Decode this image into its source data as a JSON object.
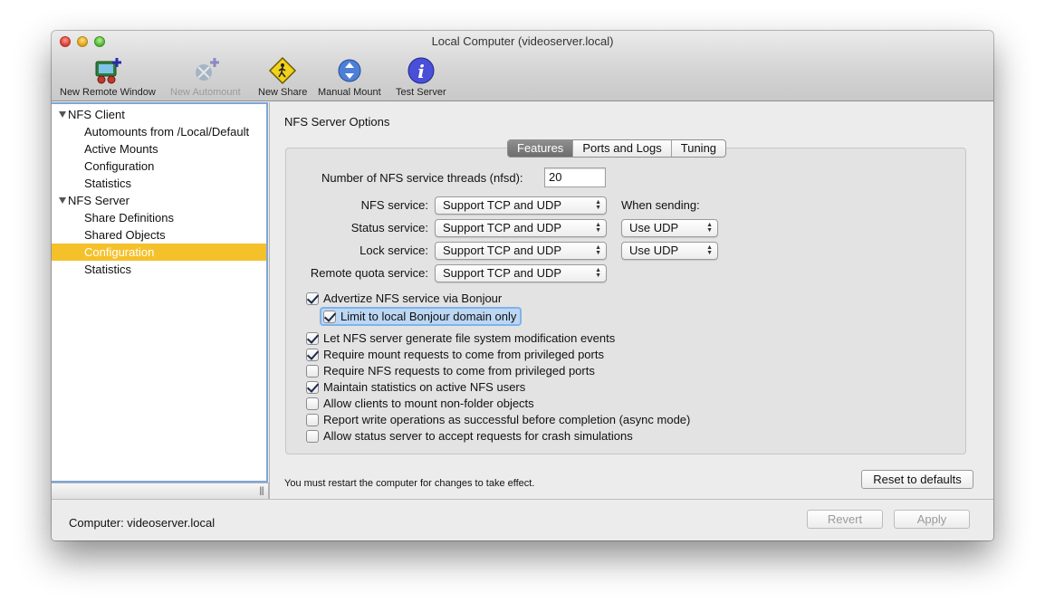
{
  "window": {
    "title": "Local Computer (videoserver.local)"
  },
  "toolbar": [
    {
      "label": "New Remote Window",
      "icon": "remote-window-icon",
      "enabled": true
    },
    {
      "label": "New Automount",
      "icon": "automount-icon",
      "enabled": false
    },
    {
      "label": "New Share",
      "icon": "share-sign-icon",
      "enabled": true
    },
    {
      "label": "Manual Mount",
      "icon": "mount-arrows-icon",
      "enabled": true
    },
    {
      "label": "Test Server",
      "icon": "info-icon",
      "enabled": true
    }
  ],
  "sidebar": {
    "groups": [
      {
        "label": "NFS Client",
        "items": [
          "Automounts from /Local/Default",
          "Active Mounts",
          "Configuration",
          "Statistics"
        ]
      },
      {
        "label": "NFS Server",
        "items": [
          "Share Definitions",
          "Shared Objects",
          "Configuration",
          "Statistics"
        ]
      }
    ],
    "selected": "NFS Server / Configuration",
    "grip": "|||"
  },
  "main": {
    "section_title": "NFS Server Options",
    "tabs": [
      {
        "label": "Features",
        "active": true
      },
      {
        "label": "Ports and Logs",
        "active": false
      },
      {
        "label": "Tuning",
        "active": false
      }
    ],
    "threads": {
      "label": "Number of NFS service threads (nfsd):",
      "value": "20"
    },
    "when_sending_label": "When sending:",
    "services": [
      {
        "label": "NFS service:",
        "value": "Support TCP and UDP",
        "send": null
      },
      {
        "label": "Status service:",
        "value": "Support TCP and UDP",
        "send": "Use UDP"
      },
      {
        "label": "Lock service:",
        "value": "Support TCP and UDP",
        "send": "Use UDP"
      },
      {
        "label": "Remote quota service:",
        "value": "Support TCP and UDP",
        "send": null
      }
    ],
    "bonjour": [
      {
        "label": "Advertize NFS service via Bonjour",
        "checked": true
      },
      {
        "label": "Limit to local Bonjour domain only",
        "checked": true,
        "focused": true
      }
    ],
    "options": [
      {
        "label": "Let NFS server generate file system modification events",
        "checked": true
      },
      {
        "label": "Require mount requests to come from privileged ports",
        "checked": true
      },
      {
        "label": "Require NFS requests to come from privileged ports",
        "checked": false
      },
      {
        "label": "Maintain statistics on active NFS users",
        "checked": true
      },
      {
        "label": "Allow clients to mount non-folder objects",
        "checked": false
      },
      {
        "label": "Report write operations as successful before completion (async mode)",
        "checked": false
      },
      {
        "label": "Allow status server to accept requests for crash simulations",
        "checked": false
      }
    ],
    "restart_note": "You must restart the computer for changes to take effect.",
    "reset_label": "Reset to defaults"
  },
  "footer": {
    "status": "Computer: videoserver.local",
    "revert_label": "Revert",
    "apply_label": "Apply"
  },
  "colors": {
    "selection": "#f5c12b",
    "focus": "#7fb3ea",
    "info_blue": "#4a4fd8"
  }
}
